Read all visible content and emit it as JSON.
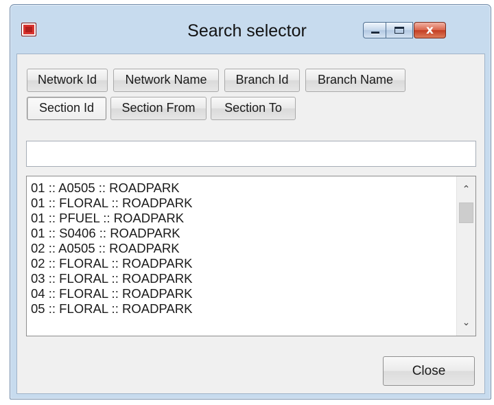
{
  "window": {
    "title": "Search selector",
    "close_glyph": "x"
  },
  "columns": {
    "network_id": "Network Id",
    "network_name": "Network Name",
    "branch_id": "Branch Id",
    "branch_name": "Branch Name",
    "section_id": "Section Id",
    "section_from": "Section From",
    "section_to": "Section To",
    "selected": "Section Id"
  },
  "search": {
    "value": "",
    "placeholder": ""
  },
  "results": {
    "items": [
      "01 :: A0505 :: ROADPARK",
      "01 :: FLORAL :: ROADPARK",
      "01 :: PFUEL :: ROADPARK",
      "01 :: S0406 :: ROADPARK",
      "02 :: A0505 :: ROADPARK",
      "02 :: FLORAL :: ROADPARK",
      "03 :: FLORAL :: ROADPARK",
      "04 :: FLORAL :: ROADPARK",
      "05 :: FLORAL :: ROADPARK"
    ],
    "scroll_up_glyph": "⌃",
    "scroll_down_glyph": "⌄"
  },
  "footer": {
    "close_label": "Close"
  },
  "icons": {
    "app": "app-castle-icon",
    "minimize": "minimize-icon",
    "maximize": "maximize-icon",
    "close": "close-icon"
  },
  "colors": {
    "titlebar": "#c7dbee",
    "close_button": "#c33d22",
    "client": "#f0f0f0"
  }
}
